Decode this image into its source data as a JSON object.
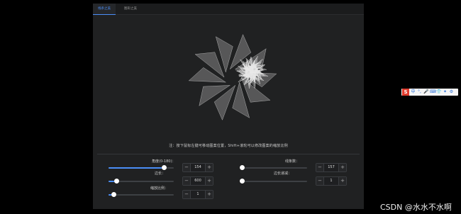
{
  "tabs": [
    {
      "label": "线条之美"
    },
    {
      "label": "图形之美"
    }
  ],
  "hint": "注：按下鼠标左键可移动图案位置，Shift+滚轮可以修改图案的缩放比例",
  "controls": {
    "angle": {
      "label": "角度(0-180)：",
      "value": "154",
      "fraction": 0.855
    },
    "lines": {
      "label": "线条数：",
      "value": "157",
      "fraction": 0.0
    },
    "side": {
      "label": "边长：",
      "value": "600",
      "fraction": 0.12
    },
    "side_rate": {
      "label": "边长递减：",
      "value": "1",
      "fraction": 0.0
    },
    "scale": {
      "label": "缩放比例：",
      "value": "1",
      "fraction": 0.08
    }
  },
  "stepper": {
    "minus": "−",
    "plus": "+"
  },
  "ime_toolbar": {
    "logo": "S",
    "items": [
      "中",
      "°,",
      "🎤",
      "⌨",
      "👕",
      "✦",
      "⚙"
    ]
  },
  "watermark": "CSDN @水水不水啊",
  "colors": {
    "accent": "#4b8ef7",
    "panel": "#202122",
    "page": "#000000"
  }
}
